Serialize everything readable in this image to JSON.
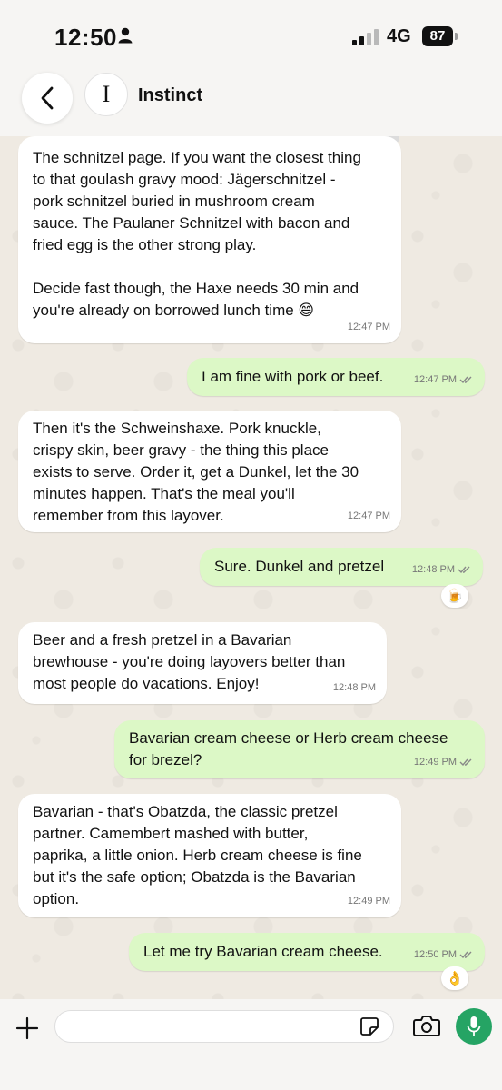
{
  "status_bar": {
    "time": "12:50",
    "network": "4G",
    "battery": "87"
  },
  "header": {
    "avatar_letter": "I",
    "contact_name": "Instinct"
  },
  "messages": [
    {
      "direction": "in",
      "text": "The schnitzel page. If you want the closest thing\nto that goulash gravy mood: Jägerschnitzel -\npork schnitzel buried in mushroom cream\nsauce. The Paulaner Schnitzel with bacon and\nfried egg is the other strong play.\n\nDecide fast though, the Haxe needs 30 min and\nyou're already on borrowed lunch time 😄",
      "time": "12:47 PM"
    },
    {
      "direction": "out",
      "text": "I am fine with pork or beef.",
      "time": "12:47 PM"
    },
    {
      "direction": "in",
      "text": "Then it's the Schweinshaxe. Pork knuckle,\ncrispy skin, beer gravy - the thing this place\nexists to serve. Order it, get a Dunkel, let the 30\nminutes happen. That's the meal you'll\nremember from this layover.",
      "time": "12:47 PM"
    },
    {
      "direction": "out",
      "text": "Sure. Dunkel and pretzel",
      "time": "12:48 PM",
      "reaction": "🍺"
    },
    {
      "direction": "in",
      "text": "Beer and a fresh pretzel in a Bavarian\nbrewhouse - you're doing layovers better than\nmost people do vacations. Enjoy!",
      "time": "12:48 PM"
    },
    {
      "direction": "out",
      "text": "Bavarian cream cheese or Herb cream cheese\nfor brezel?",
      "time": "12:49 PM"
    },
    {
      "direction": "in",
      "text": "Bavarian - that's Obatzda, the classic pretzel\npartner. Camembert mashed with butter,\npaprika, a little onion. Herb cream cheese is fine\nbut it's the safe option; Obatzda is the Bavarian\noption.",
      "time": "12:49 PM"
    },
    {
      "direction": "out",
      "text": "Let me try Bavarian cream cheese.",
      "time": "12:50 PM",
      "reaction": "👌"
    }
  ],
  "composer": {
    "value": "",
    "placeholder": ""
  },
  "colors": {
    "incoming_bubble": "#ffffff",
    "outgoing_bubble": "#dcf8c6",
    "wallpaper": "#efeae2",
    "mic_button": "#25a464"
  }
}
